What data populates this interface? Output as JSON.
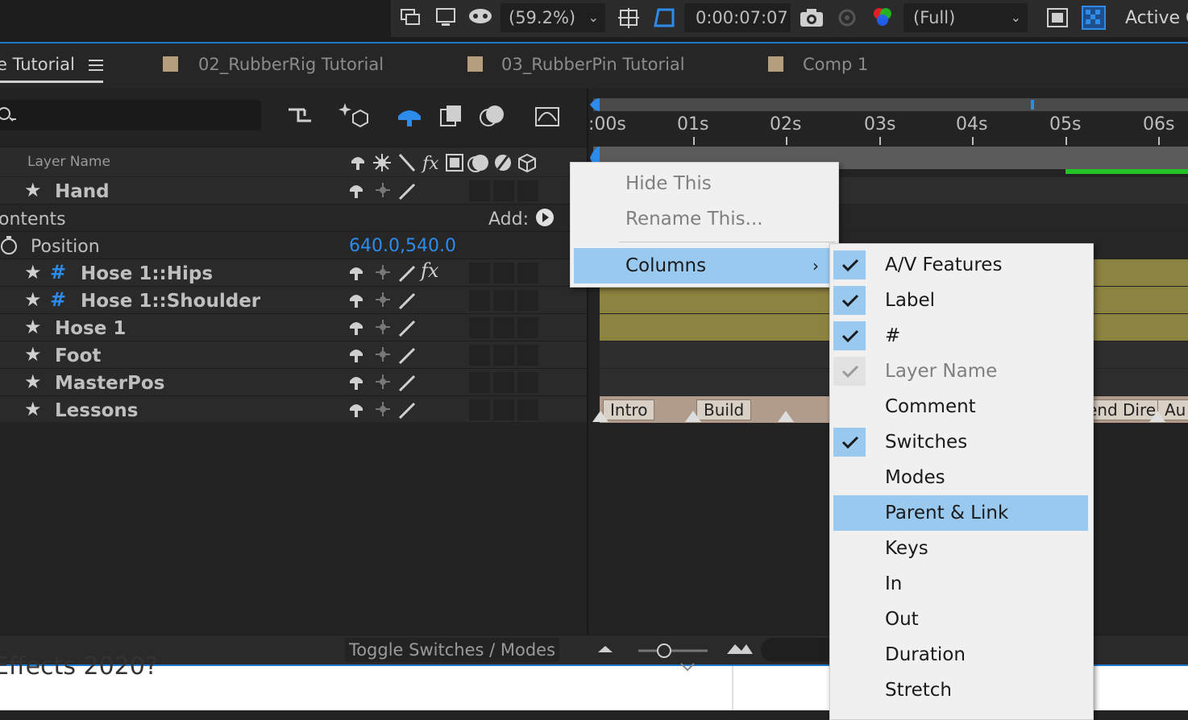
{
  "viewer_toolbar": {
    "zoom": "(59.2%)",
    "timecode": "0:00:07:07",
    "resolution": "(Full)",
    "camera": "Active C"
  },
  "tabs": [
    {
      "label": "e Tutorial",
      "active": true
    },
    {
      "label": "02_RubberRig Tutorial",
      "active": false
    },
    {
      "label": "03_RubberPin Tutorial",
      "active": false
    },
    {
      "label": "Comp 1",
      "active": false
    }
  ],
  "layer_header": {
    "layer_name": "Layer Name"
  },
  "layers": [
    {
      "name": "Hand"
    },
    {
      "contents": "ontents",
      "add_label": "Add:"
    },
    {
      "property": "Position",
      "value": "640.0,540.0"
    },
    {
      "name": "Hose 1::Hips",
      "hash": "#",
      "fx": "fx"
    },
    {
      "name": "Hose 1::Shoulder",
      "hash": "#"
    },
    {
      "name": "Hose 1"
    },
    {
      "name": "Foot"
    },
    {
      "name": "MasterPos"
    },
    {
      "name": "Lessons"
    }
  ],
  "timeline": {
    "ticks": [
      ":00s",
      "01s",
      "02s",
      "03s",
      "04s",
      "05s",
      "06s"
    ],
    "markers": [
      "Intro",
      "Build",
      "end Dire",
      "Au"
    ]
  },
  "bottom_bar": {
    "toggle_label": "Toggle Switches / Modes"
  },
  "web_text": "Effects 2020?",
  "context_menu": {
    "items": [
      {
        "label": "Hide This",
        "disabled": true
      },
      {
        "label": "Rename This...",
        "disabled": true
      },
      {
        "label": "Columns",
        "submenu": true,
        "highlighted": true
      }
    ]
  },
  "columns_submenu": {
    "items": [
      {
        "label": "A/V Features",
        "checked": true
      },
      {
        "label": "Label",
        "checked": true
      },
      {
        "label": "#",
        "checked": true
      },
      {
        "label": "Layer Name",
        "checked": true,
        "disabled": true
      },
      {
        "label": "Comment",
        "checked": false
      },
      {
        "label": "Switches",
        "checked": true
      },
      {
        "label": "Modes",
        "checked": false
      },
      {
        "label": "Parent & Link",
        "checked": false,
        "highlighted": true
      },
      {
        "label": "Keys",
        "checked": false
      },
      {
        "label": "In",
        "checked": false
      },
      {
        "label": "Out",
        "checked": false
      },
      {
        "label": "Duration",
        "checked": false
      },
      {
        "label": "Stretch",
        "checked": false
      }
    ]
  },
  "colors": {
    "accent_blue": "#1f77c9",
    "menu_highlight": "#99c9ef",
    "olive_bar": "#8c8340",
    "label_swatch": "#b59e7d"
  }
}
